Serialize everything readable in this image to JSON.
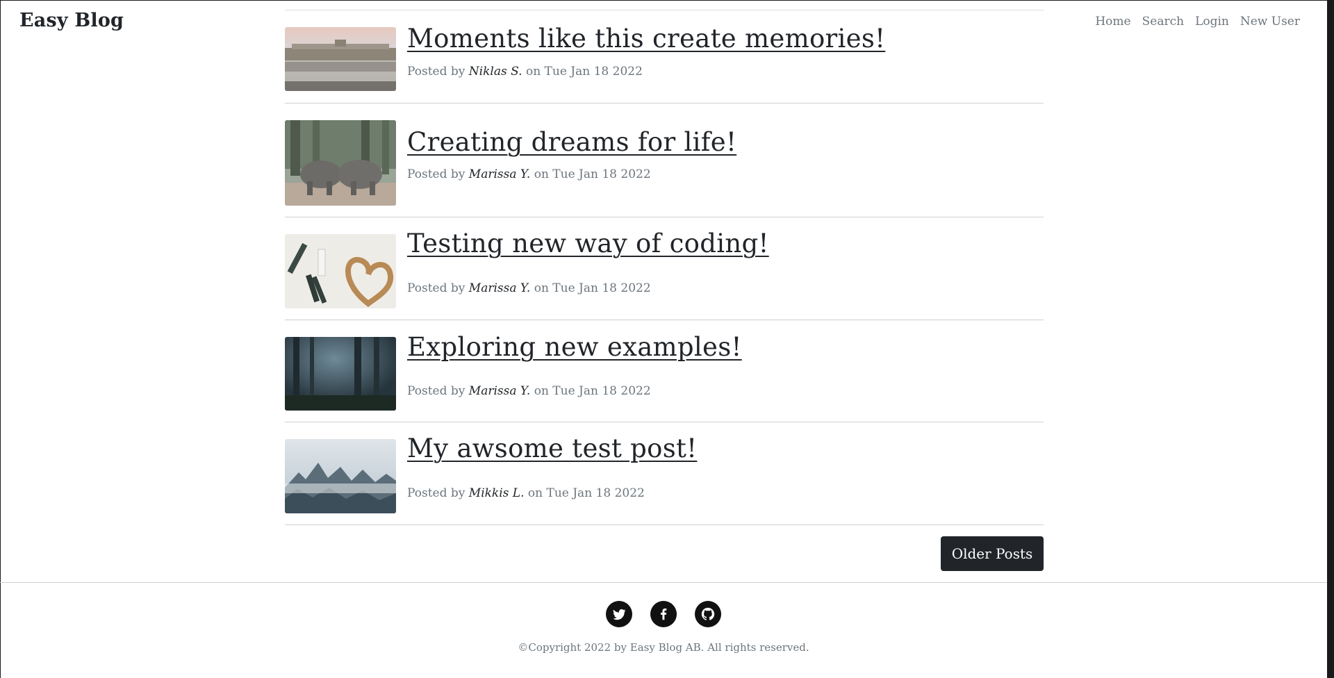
{
  "navbar": {
    "brand": "Easy Blog",
    "links": [
      "Home",
      "Search",
      "Login",
      "New User"
    ]
  },
  "posts": [
    {
      "title": "Moments like this create memories!",
      "posted_by": "Posted by",
      "author": "Niklas S.",
      "date": "on Tue Jan 18 2022",
      "image": "palace-reflection"
    },
    {
      "title": "Creating dreams for life!",
      "posted_by": "Posted by",
      "author": "Marissa Y.",
      "date": "on Tue Jan 18 2022",
      "image": "elephants"
    },
    {
      "title": "Testing new way of coding!",
      "posted_by": "Posted by",
      "author": "Marissa Y.",
      "date": "on Tue Jan 18 2022",
      "image": "hair-heart"
    },
    {
      "title": "Exploring new examples!",
      "posted_by": "Posted by",
      "author": "Marissa Y.",
      "date": "on Tue Jan 18 2022",
      "image": "dark-forest"
    },
    {
      "title": "My awsome test post!",
      "posted_by": "Posted by",
      "author": "Mikkis L.",
      "date": "on Tue Jan 18 2022",
      "image": "misty-forest"
    }
  ],
  "pagination": {
    "older_label": "Older Posts"
  },
  "footer": {
    "social": [
      "twitter-icon",
      "facebook-icon",
      "github-icon"
    ],
    "copyright": "©Copyright 2022 by Easy Blog AB. All rights reserved."
  }
}
